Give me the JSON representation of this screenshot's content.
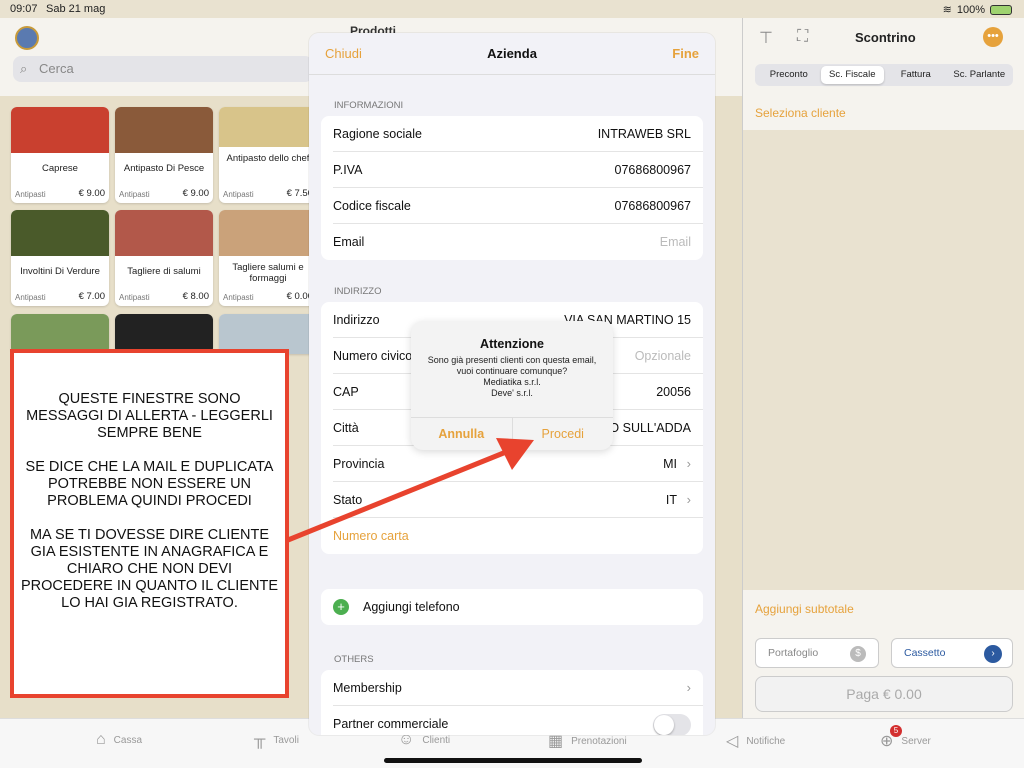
{
  "status": {
    "time": "09:07",
    "date": "Sab 21 mag",
    "battery": "100%"
  },
  "products_panel": {
    "title": "Prodotti",
    "search_placeholder": "Cerca",
    "items": [
      {
        "name": "Caprese",
        "category": "Antipasti",
        "price": "€ 9.00",
        "color": "#c9402f"
      },
      {
        "name": "Antipasto Di Pesce",
        "category": "Antipasti",
        "price": "€ 9.00",
        "color": "#8a5a3a"
      },
      {
        "name": "Antipasto dello chef",
        "category": "Antipasti",
        "price": "€ 7.50",
        "color": "#d8c48a"
      },
      {
        "name": "Involtini Di Verdure",
        "category": "Antipasti",
        "price": "€ 7.00",
        "color": "#4a5a2a"
      },
      {
        "name": "Tagliere di salumi",
        "category": "Antipasti",
        "price": "€ 8.00",
        "color": "#b2584a"
      },
      {
        "name": "Tagliere salumi e formaggi",
        "category": "Antipasti",
        "price": "€ 0.00",
        "color": "#caa27a"
      }
    ]
  },
  "receipt": {
    "title": "Scontrino",
    "tabs": [
      "Preconto",
      "Sc. Fiscale",
      "Fattura",
      "Sc. Parlante"
    ],
    "active_tab": "Sc. Fiscale",
    "select_client": "Seleziona cliente",
    "add_subtotal": "Aggiungi subtotale",
    "wallet": "Portafoglio",
    "drawer": "Cassetto",
    "pay": "Paga € 0.00"
  },
  "tabbar": {
    "items": [
      "Cassa",
      "Tavoli",
      "Clienti",
      "Prenotazioni",
      "Notifiche",
      "Server"
    ],
    "server_badge": "5"
  },
  "sheet": {
    "close": "Chiudi",
    "title": "Azienda",
    "done": "Fine",
    "info_label": "INFORMAZIONI",
    "info_rows": [
      {
        "label": "Ragione sociale",
        "value": "INTRAWEB SRL"
      },
      {
        "label": "P.IVA",
        "value": "07686800967"
      },
      {
        "label": "Codice fiscale",
        "value": "07686800967"
      },
      {
        "label": "Email",
        "placeholder": "Email"
      }
    ],
    "address_label": "INDIRIZZO",
    "address": {
      "street_label": "Indirizzo",
      "street_value": "VIA SAN MARTINO 15",
      "civic_label": "Numero civico",
      "civic_placeholder": "Opzionale",
      "cap_label": "CAP",
      "cap_value": "20056",
      "city_label": "Città",
      "city_value": "O SULL'ADDA",
      "province_label": "Provincia",
      "province_value": "MI",
      "country_label": "Stato",
      "country_value": "IT",
      "card_link": "Numero carta"
    },
    "add_phone": "Aggiungi telefono",
    "others_label": "OTHERS",
    "membership": "Membership",
    "partner": "Partner commerciale"
  },
  "alert": {
    "title": "Attenzione",
    "message": "Sono già presenti clienti con questa email, vuoi continuare comunque?",
    "clients": [
      "Mediatika s.r.l.",
      "Deve' s.r.l."
    ],
    "cancel": "Annulla",
    "proceed": "Procedi"
  },
  "annotation": {
    "p1": "QUESTE FINESTRE SONO MESSAGGI DI ALLERTA - LEGGERLI SEMPRE BENE",
    "p2": "SE DICE CHE LA MAIL E DUPLICATA POTREBBE NON ESSERE UN PROBLEMA QUINDI PROCEDI",
    "p3": "MA SE TI DOVESSE DIRE CLIENTE GIA ESISTENTE IN ANAGRAFICA E CHIARO CHE NON DEVI PROCEDERE IN QUANTO IL CLIENTE LO HAI GIA REGISTRATO.",
    "color": "#e8432e"
  }
}
